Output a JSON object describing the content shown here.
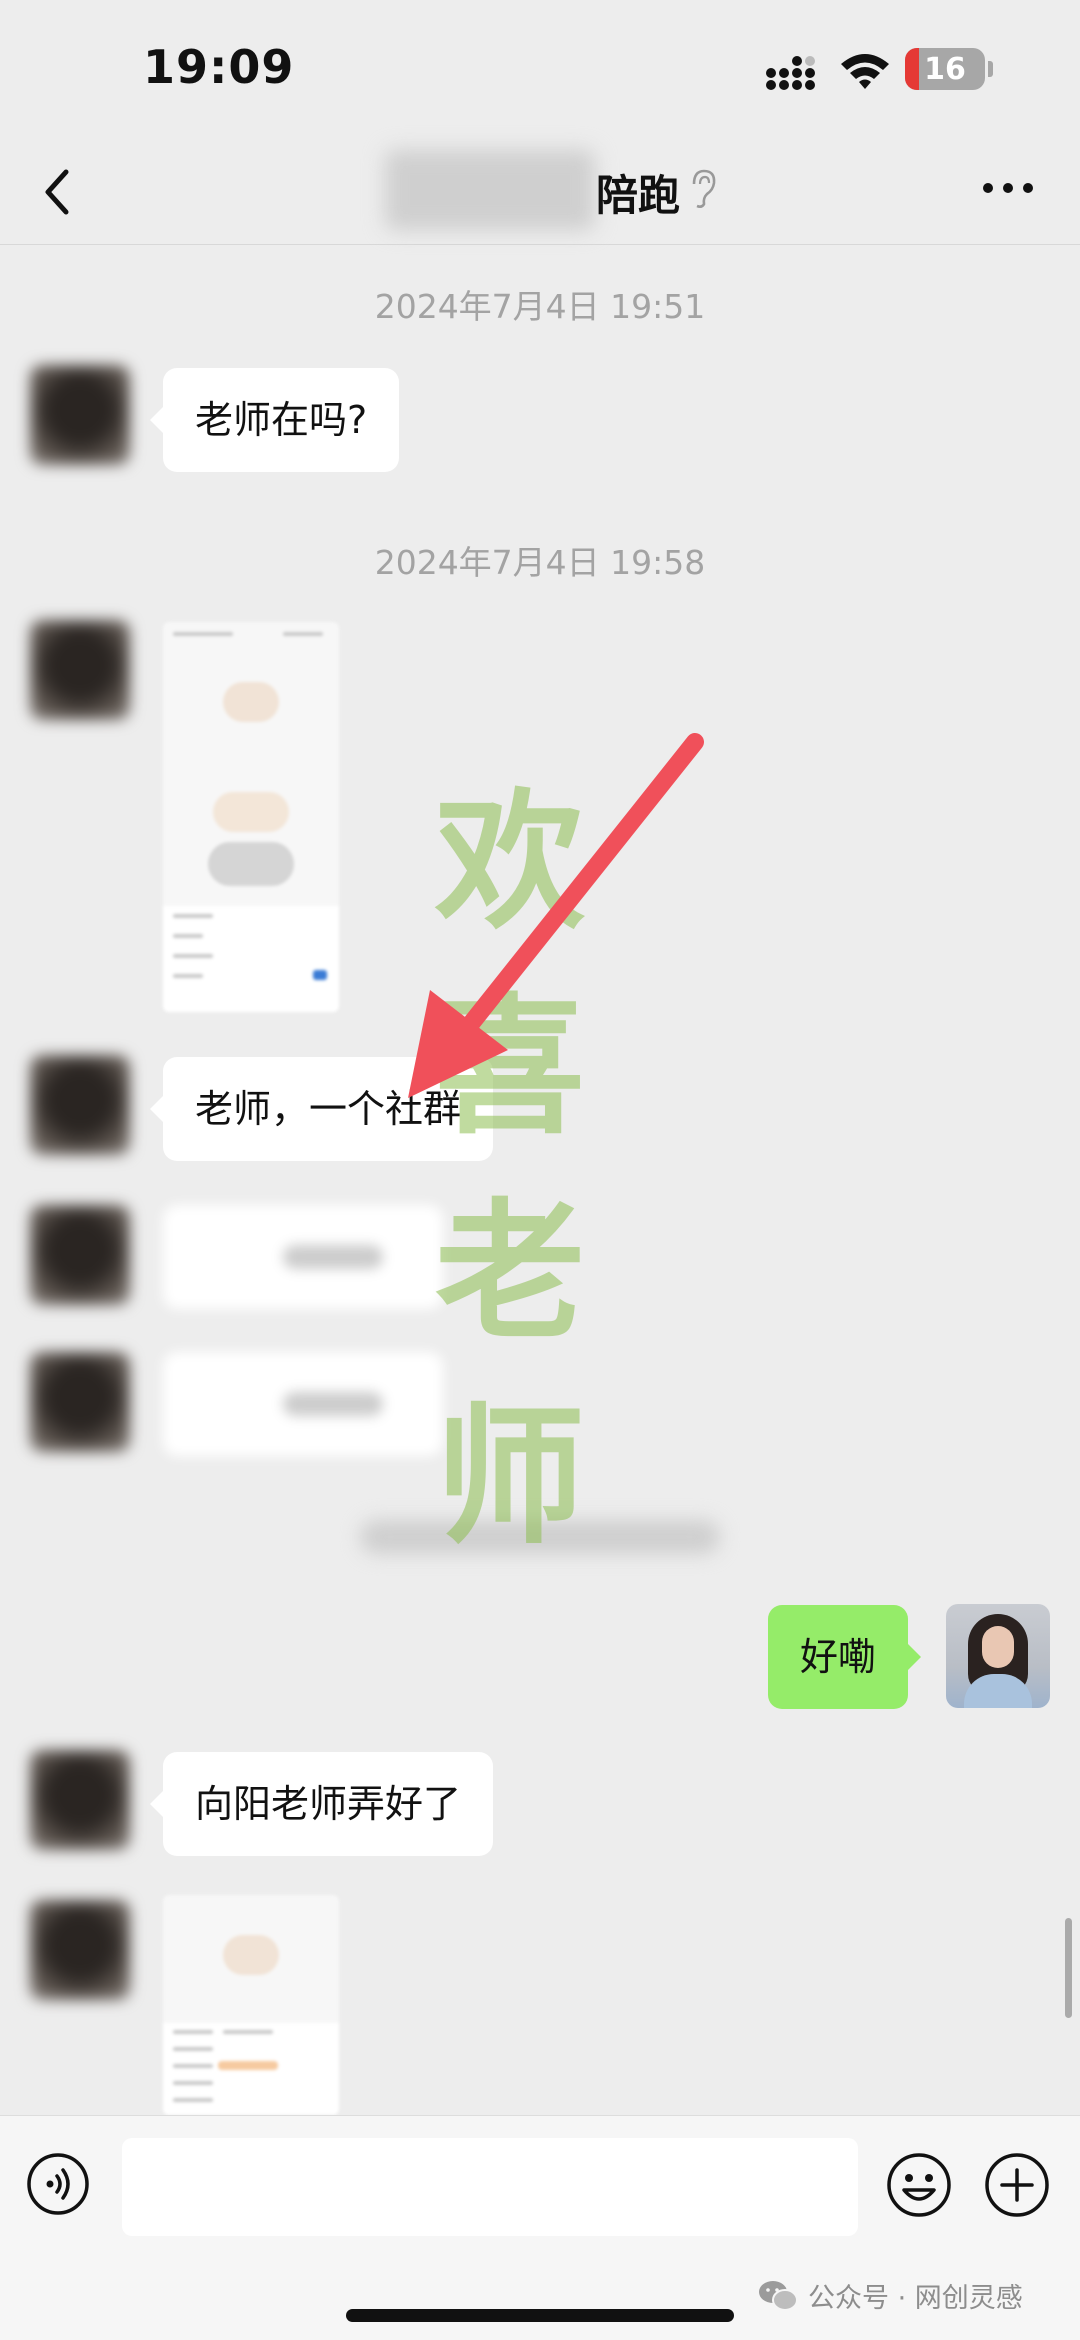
{
  "status_bar": {
    "time": "19:09",
    "battery": "16"
  },
  "nav": {
    "title": "陪跑",
    "back_icon": "chevron-left-icon",
    "more_icon": "more-dots-icon"
  },
  "messages": {
    "ts1": "2024年7月4日 19:51",
    "m1": "老师在吗?",
    "ts2": "2024年7月4日 19:58",
    "m2": "老师，一个社群",
    "m_self": "好嘞",
    "m3": "向阳老师弄好了"
  },
  "watermark": {
    "chars": [
      "欢",
      "喜",
      "老",
      "师"
    ],
    "color": "#8cbe50"
  },
  "footer_tag": "公众号 · 网创灵感",
  "colors": {
    "self_bubble": "#95ec69",
    "background": "#ededed",
    "arrow": "#f0505a"
  }
}
